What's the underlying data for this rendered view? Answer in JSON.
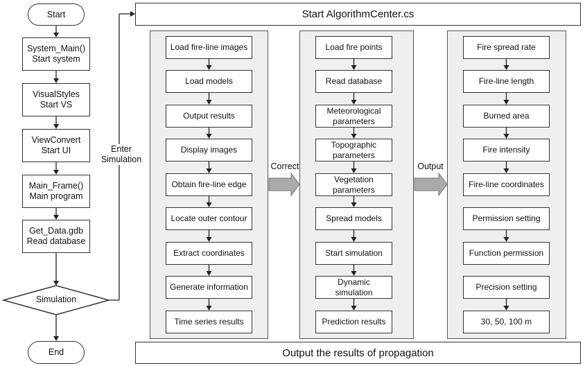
{
  "left_flow": {
    "start": "Start",
    "steps": [
      "System_Main()\nStart system",
      "VisualStyles\nStart VS",
      "ViewConvert\nStart UI",
      "Main_Frame()\nMain program",
      "Get_Data.gdb\nRead database"
    ],
    "decision": "Simulation",
    "end": "End",
    "enter_label": "Enter\nSimulation"
  },
  "top_box": "Start AlgorithmCenter.cs",
  "bottom_box": "Output the results of propagation",
  "panels": [
    {
      "items": [
        "Load fire-line images",
        "Load models",
        "Output results",
        "Display images",
        "Obtain fire-line edge",
        "Locate outer contour",
        "Extract coordinates",
        "Generate information",
        "Time series results"
      ],
      "arrows_after": [
        0,
        1,
        2,
        3,
        4,
        5,
        6,
        7
      ]
    },
    {
      "items": [
        "Load fire points",
        "Read database",
        "Meteorological\nparameters",
        "Topographic\nparameters",
        "Vegetation\nparameters",
        "Spread models",
        "Start simulation",
        "Dynamic\nsimulation",
        "Prediction results"
      ],
      "arrows_after": [
        0,
        1,
        2,
        3,
        4,
        5,
        6,
        7
      ]
    },
    {
      "items": [
        "Fire spread rate",
        "Fire-line length",
        "Burned area",
        "Fire intensity",
        "Fire-line coordinates",
        "Permission setting",
        "Function permission",
        "Precision setting",
        "30, 50, 100 m"
      ],
      "arrows_after": [
        0,
        1,
        2,
        3,
        5,
        7
      ]
    }
  ],
  "connectors": {
    "correct": "Correct",
    "output": "Output"
  },
  "colors": {
    "panel_bg": "#efefef",
    "block_arrow": "#aaaaaa",
    "stroke": "#333333"
  }
}
